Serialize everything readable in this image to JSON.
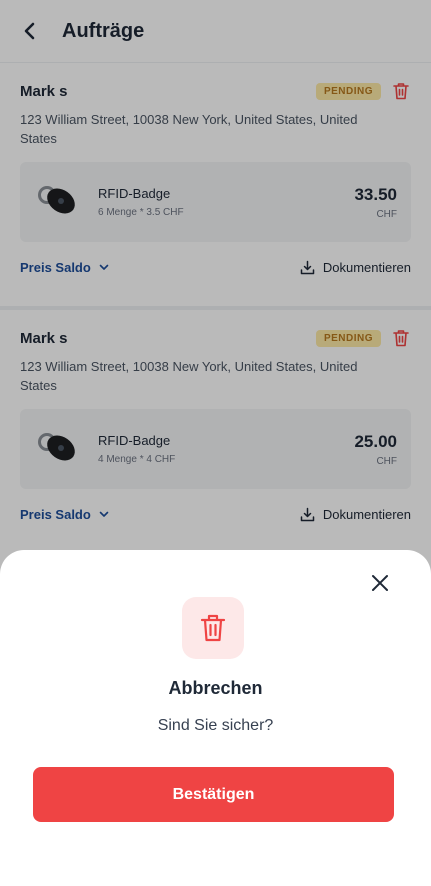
{
  "header": {
    "title": "Aufträge"
  },
  "orders": [
    {
      "customer": "Mark s",
      "status": "PENDING",
      "address": "123 William Street, 10038 New York, United States, United States",
      "product": {
        "name": "RFID-Badge",
        "qty_line": "6 Menge * 3.5 CHF",
        "price": "33.50",
        "currency": "CHF"
      },
      "saldo_label": "Preis Saldo",
      "doc_label": "Dokumentieren"
    },
    {
      "customer": "Mark s",
      "status": "PENDING",
      "address": "123 William Street, 10038 New York, United States, United States",
      "product": {
        "name": "RFID-Badge",
        "qty_line": "4 Menge * 4 CHF",
        "price": "25.00",
        "currency": "CHF"
      },
      "saldo_label": "Preis Saldo",
      "doc_label": "Dokumentieren"
    }
  ],
  "sheet": {
    "title": "Abbrechen",
    "message": "Sind Sie sicher?",
    "confirm_label": "Bestätigen"
  },
  "colors": {
    "danger": "#ef4444",
    "link": "#1e4e9a",
    "badge_bg": "#fde9a6",
    "badge_text": "#b7791f"
  },
  "icons": [
    "chevron-left-icon",
    "trash-icon",
    "chevron-down-icon",
    "download-icon",
    "close-icon"
  ]
}
